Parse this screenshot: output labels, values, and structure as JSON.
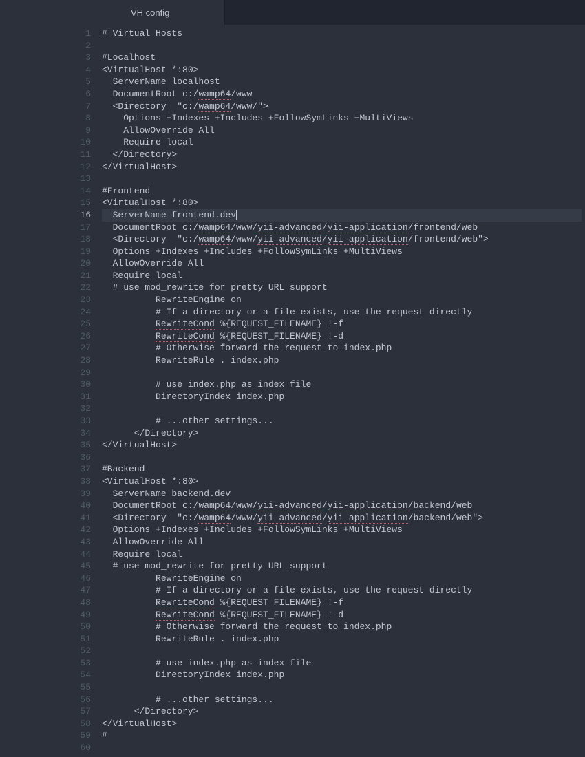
{
  "tab": {
    "title": "VH config"
  },
  "editor": {
    "active_line": 16,
    "lines": [
      {
        "n": 1,
        "segs": [
          {
            "t": "# Virtual Hosts"
          }
        ]
      },
      {
        "n": 2,
        "segs": [
          {
            "t": ""
          }
        ]
      },
      {
        "n": 3,
        "segs": [
          {
            "t": "#Localhost"
          }
        ]
      },
      {
        "n": 4,
        "segs": [
          {
            "t": "<VirtualHost *:80>"
          }
        ]
      },
      {
        "n": 5,
        "segs": [
          {
            "t": "  ServerName localhost"
          }
        ]
      },
      {
        "n": 6,
        "segs": [
          {
            "t": "  DocumentRoot c:/"
          },
          {
            "t": "wamp64",
            "sp": true
          },
          {
            "t": "/www"
          }
        ]
      },
      {
        "n": 7,
        "segs": [
          {
            "t": "  <Directory  \"c:/"
          },
          {
            "t": "wamp64",
            "sp": true
          },
          {
            "t": "/www/\">"
          }
        ]
      },
      {
        "n": 8,
        "segs": [
          {
            "t": "    Options +Indexes +Includes +FollowSymLinks +MultiViews"
          }
        ]
      },
      {
        "n": 9,
        "segs": [
          {
            "t": "    AllowOverride All"
          }
        ]
      },
      {
        "n": 10,
        "segs": [
          {
            "t": "    Require local"
          }
        ]
      },
      {
        "n": 11,
        "segs": [
          {
            "t": "  </Directory>"
          }
        ]
      },
      {
        "n": 12,
        "segs": [
          {
            "t": "</VirtualHost>"
          }
        ]
      },
      {
        "n": 13,
        "segs": [
          {
            "t": ""
          }
        ]
      },
      {
        "n": 14,
        "segs": [
          {
            "t": "#Frontend"
          }
        ]
      },
      {
        "n": 15,
        "segs": [
          {
            "t": "<VirtualHost *:80>"
          }
        ]
      },
      {
        "n": 16,
        "segs": [
          {
            "t": "  ServerName frontend.dev"
          }
        ],
        "cursor": true
      },
      {
        "n": 17,
        "segs": [
          {
            "t": "  DocumentRoot c:/"
          },
          {
            "t": "wamp64",
            "sp": true
          },
          {
            "t": "/www/"
          },
          {
            "t": "yii-advanced",
            "sp": true
          },
          {
            "t": "/"
          },
          {
            "t": "yii-application",
            "sp": true
          },
          {
            "t": "/frontend/web"
          }
        ]
      },
      {
        "n": 18,
        "segs": [
          {
            "t": "  <Directory  \"c:/"
          },
          {
            "t": "wamp64",
            "sp": true
          },
          {
            "t": "/www/"
          },
          {
            "t": "yii-advanced",
            "sp": true
          },
          {
            "t": "/"
          },
          {
            "t": "yii-application",
            "sp": true
          },
          {
            "t": "/frontend/web\">"
          }
        ]
      },
      {
        "n": 19,
        "segs": [
          {
            "t": "  Options +Indexes +Includes +FollowSymLinks +MultiViews"
          }
        ]
      },
      {
        "n": 20,
        "segs": [
          {
            "t": "  AllowOverride All"
          }
        ]
      },
      {
        "n": 21,
        "segs": [
          {
            "t": "  Require local"
          }
        ]
      },
      {
        "n": 22,
        "segs": [
          {
            "t": "  # use mod_rewrite for pretty URL support"
          }
        ]
      },
      {
        "n": 23,
        "segs": [
          {
            "t": "          RewriteEngine on"
          }
        ]
      },
      {
        "n": 24,
        "segs": [
          {
            "t": "          # If a directory or a file exists, use the request directly"
          }
        ]
      },
      {
        "n": 25,
        "segs": [
          {
            "t": "          "
          },
          {
            "t": "RewriteCond",
            "sp": true
          },
          {
            "t": " %{REQUEST_FILENAME} !-f"
          }
        ]
      },
      {
        "n": 26,
        "segs": [
          {
            "t": "          "
          },
          {
            "t": "RewriteCond",
            "sp": true
          },
          {
            "t": " %{REQUEST_FILENAME} !-d"
          }
        ]
      },
      {
        "n": 27,
        "segs": [
          {
            "t": "          # Otherwise forward the request to index.php"
          }
        ]
      },
      {
        "n": 28,
        "segs": [
          {
            "t": "          RewriteRule . index.php"
          }
        ]
      },
      {
        "n": 29,
        "segs": [
          {
            "t": ""
          }
        ]
      },
      {
        "n": 30,
        "segs": [
          {
            "t": "          # use index.php as index file"
          }
        ]
      },
      {
        "n": 31,
        "segs": [
          {
            "t": "          DirectoryIndex index.php"
          }
        ]
      },
      {
        "n": 32,
        "segs": [
          {
            "t": ""
          }
        ]
      },
      {
        "n": 33,
        "segs": [
          {
            "t": "          # ...other settings..."
          }
        ]
      },
      {
        "n": 34,
        "segs": [
          {
            "t": "      </Directory>"
          }
        ]
      },
      {
        "n": 35,
        "segs": [
          {
            "t": "</VirtualHost>"
          }
        ]
      },
      {
        "n": 36,
        "segs": [
          {
            "t": ""
          }
        ]
      },
      {
        "n": 37,
        "segs": [
          {
            "t": "#Backend"
          }
        ]
      },
      {
        "n": 38,
        "segs": [
          {
            "t": "<VirtualHost *:80>"
          }
        ]
      },
      {
        "n": 39,
        "segs": [
          {
            "t": "  ServerName backend.dev"
          }
        ]
      },
      {
        "n": 40,
        "segs": [
          {
            "t": "  DocumentRoot c:/"
          },
          {
            "t": "wamp64",
            "sp": true
          },
          {
            "t": "/www/"
          },
          {
            "t": "yii-advanced",
            "sp": true
          },
          {
            "t": "/"
          },
          {
            "t": "yii-application",
            "sp": true
          },
          {
            "t": "/backend/web"
          }
        ]
      },
      {
        "n": 41,
        "segs": [
          {
            "t": "  <Directory  \"c:/"
          },
          {
            "t": "wamp64",
            "sp": true
          },
          {
            "t": "/www/"
          },
          {
            "t": "yii-advanced",
            "sp": true
          },
          {
            "t": "/"
          },
          {
            "t": "yii-application",
            "sp": true
          },
          {
            "t": "/backend/web\">"
          }
        ]
      },
      {
        "n": 42,
        "segs": [
          {
            "t": "  Options +Indexes +Includes +FollowSymLinks +MultiViews"
          }
        ]
      },
      {
        "n": 43,
        "segs": [
          {
            "t": "  AllowOverride All"
          }
        ]
      },
      {
        "n": 44,
        "segs": [
          {
            "t": "  Require local"
          }
        ]
      },
      {
        "n": 45,
        "segs": [
          {
            "t": "  # use mod_rewrite for pretty URL support"
          }
        ]
      },
      {
        "n": 46,
        "segs": [
          {
            "t": "          RewriteEngine on"
          }
        ]
      },
      {
        "n": 47,
        "segs": [
          {
            "t": "          # If a directory or a file exists, use the request directly"
          }
        ]
      },
      {
        "n": 48,
        "segs": [
          {
            "t": "          "
          },
          {
            "t": "RewriteCond",
            "sp": true
          },
          {
            "t": " %{REQUEST_FILENAME} !-f"
          }
        ]
      },
      {
        "n": 49,
        "segs": [
          {
            "t": "          "
          },
          {
            "t": "RewriteCond",
            "sp": true
          },
          {
            "t": " %{REQUEST_FILENAME} !-d"
          }
        ]
      },
      {
        "n": 50,
        "segs": [
          {
            "t": "          # Otherwise forward the request to index.php"
          }
        ]
      },
      {
        "n": 51,
        "segs": [
          {
            "t": "          RewriteRule . index.php"
          }
        ]
      },
      {
        "n": 52,
        "segs": [
          {
            "t": ""
          }
        ]
      },
      {
        "n": 53,
        "segs": [
          {
            "t": "          # use index.php as index file"
          }
        ]
      },
      {
        "n": 54,
        "segs": [
          {
            "t": "          DirectoryIndex index.php"
          }
        ]
      },
      {
        "n": 55,
        "segs": [
          {
            "t": ""
          }
        ]
      },
      {
        "n": 56,
        "segs": [
          {
            "t": "          # ...other settings..."
          }
        ]
      },
      {
        "n": 57,
        "segs": [
          {
            "t": "      </Directory>"
          }
        ]
      },
      {
        "n": 58,
        "segs": [
          {
            "t": "</VirtualHost>"
          }
        ]
      },
      {
        "n": 59,
        "segs": [
          {
            "t": "#"
          }
        ]
      },
      {
        "n": 60,
        "segs": [
          {
            "t": ""
          }
        ]
      }
    ]
  }
}
